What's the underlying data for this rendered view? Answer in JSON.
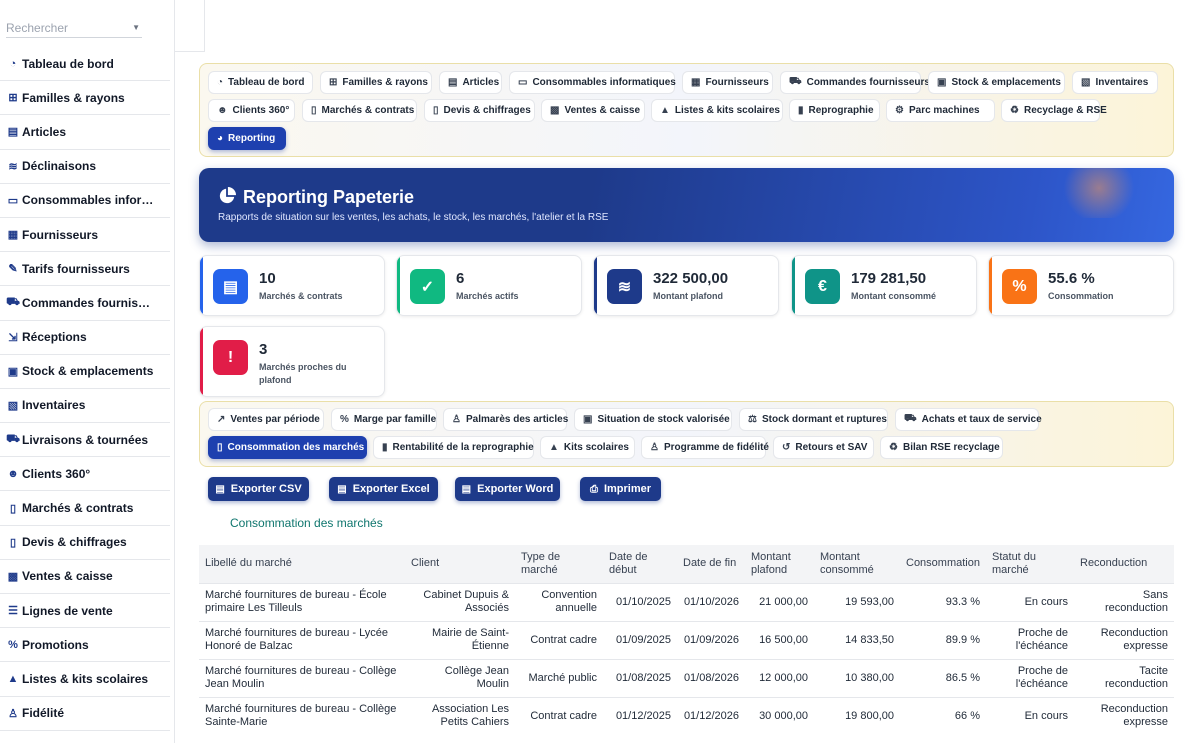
{
  "sidebar": {
    "search_placeholder": "Rechercher",
    "items": [
      {
        "label": "Tableau de bord",
        "icon": "gauge-icon"
      },
      {
        "label": "Familles & rayons",
        "icon": "sitemap-icon"
      },
      {
        "label": "Articles",
        "icon": "book-icon"
      },
      {
        "label": "Déclinaisons",
        "icon": "layers-icon"
      },
      {
        "label": "Consommables infor…",
        "icon": "printer-icon"
      },
      {
        "label": "Fournisseurs",
        "icon": "truck-loading-icon"
      },
      {
        "label": "Tarifs fournisseurs",
        "icon": "tags-icon"
      },
      {
        "label": "Commandes fournis…",
        "icon": "cart-icon"
      },
      {
        "label": "Réceptions",
        "icon": "dolly-icon"
      },
      {
        "label": "Stock & emplacements",
        "icon": "warehouse-icon"
      },
      {
        "label": "Inventaires",
        "icon": "clipboard-check-icon"
      },
      {
        "label": "Livraisons & tournées",
        "icon": "truck-icon"
      },
      {
        "label": "Clients 360°",
        "icon": "users-icon"
      },
      {
        "label": "Marchés & contrats",
        "icon": "file-contract-icon"
      },
      {
        "label": "Devis & chiffrages",
        "icon": "file-invoice-icon"
      },
      {
        "label": "Ventes & caisse",
        "icon": "cash-register-icon"
      },
      {
        "label": "Lignes de vente",
        "icon": "list-icon"
      },
      {
        "label": "Promotions",
        "icon": "percent-icon"
      },
      {
        "label": "Listes & kits scolaires",
        "icon": "graduation-cap-icon"
      },
      {
        "label": "Fidélité",
        "icon": "award-icon"
      }
    ]
  },
  "modules": [
    {
      "label": "Tableau de bord",
      "icon": "gauge-icon",
      "glyph": "◔"
    },
    {
      "label": "Familles & rayons",
      "icon": "sitemap-icon",
      "glyph": "⊞"
    },
    {
      "label": "Articles",
      "icon": "book-icon",
      "glyph": "▤"
    },
    {
      "label": "Consommables informatiques",
      "icon": "printer-icon",
      "glyph": "▭"
    },
    {
      "label": "Fournisseurs",
      "icon": "truck-loading-icon",
      "glyph": "▦"
    },
    {
      "label": "Commandes fournisseurs",
      "icon": "cart-icon",
      "glyph": "⛟"
    },
    {
      "label": "Stock & emplacements",
      "icon": "warehouse-icon",
      "glyph": "▣"
    },
    {
      "label": "Inventaires",
      "icon": "clipboard-check-icon",
      "glyph": "▧"
    },
    {
      "label": "Clients 360°",
      "icon": "users-icon",
      "glyph": "☻"
    },
    {
      "label": "Marchés & contrats",
      "icon": "file-contract-icon",
      "glyph": "▯"
    },
    {
      "label": "Devis & chiffrages",
      "icon": "file-invoice-icon",
      "glyph": "▯"
    },
    {
      "label": "Ventes & caisse",
      "icon": "cash-register-icon",
      "glyph": "▩"
    },
    {
      "label": "Listes & kits scolaires",
      "icon": "graduation-cap-icon",
      "glyph": "▲"
    },
    {
      "label": "Reprographie",
      "icon": "copy-icon",
      "glyph": "▮"
    },
    {
      "label": "Parc machines",
      "icon": "cogs-icon",
      "glyph": "⚙"
    },
    {
      "label": "Recyclage & RSE",
      "icon": "recycle-icon",
      "glyph": "♻"
    },
    {
      "label": "Reporting",
      "icon": "pie-chart-icon",
      "glyph": "◕",
      "active": true
    }
  ],
  "hero": {
    "title": "Reporting Papeterie",
    "subtitle": "Rapports de situation sur les ventes, les achats, le stock, les marchés, l'atelier et la RSE"
  },
  "kpis": [
    {
      "value": "10",
      "label": "Marchés & contrats",
      "color": "#2563eb",
      "icon": "file-icon",
      "glyph": "▤"
    },
    {
      "value": "6",
      "label": "Marchés actifs",
      "color": "#10b981",
      "icon": "check-circle-icon",
      "glyph": "✓"
    },
    {
      "value": "322 500,00",
      "label": "Montant plafond",
      "color": "#1e3a8a",
      "icon": "coins-icon",
      "glyph": "≋"
    },
    {
      "value": "179 281,50",
      "label": "Montant consommé",
      "color": "#0f9488",
      "icon": "euro-icon",
      "glyph": "€"
    },
    {
      "value": "55.6 %",
      "label": "Consommation",
      "color": "#f97316",
      "icon": "percent-icon",
      "glyph": "%"
    },
    {
      "value": "3",
      "label": "Marchés proches du plafond",
      "color": "#e11d48",
      "icon": "warning-icon",
      "glyph": "!"
    }
  ],
  "reports": [
    {
      "label": "Ventes par période",
      "icon": "chart-line-icon",
      "glyph": "↗"
    },
    {
      "label": "Marge par famille",
      "icon": "percent-icon",
      "glyph": "%"
    },
    {
      "label": "Palmarès des articles",
      "icon": "medal-icon",
      "glyph": "♙"
    },
    {
      "label": "Situation de stock valorisée",
      "icon": "warehouse-icon",
      "glyph": "▣"
    },
    {
      "label": "Stock dormant et ruptures",
      "icon": "balance-icon",
      "glyph": "⚖"
    },
    {
      "label": "Achats et taux de service",
      "icon": "cart-icon",
      "glyph": "⛟"
    },
    {
      "label": "Consommation des marchés",
      "icon": "file-contract-icon",
      "glyph": "▯",
      "active": true
    },
    {
      "label": "Rentabilité de la reprographie",
      "icon": "copy-icon",
      "glyph": "▮"
    },
    {
      "label": "Kits scolaires",
      "icon": "graduation-cap-icon",
      "glyph": "▲"
    },
    {
      "label": "Programme de fidélité",
      "icon": "award-icon",
      "glyph": "♙"
    },
    {
      "label": "Retours et SAV",
      "icon": "undo-icon",
      "glyph": "↺"
    },
    {
      "label": "Bilan RSE recyclage",
      "icon": "recycle-icon",
      "glyph": "♻"
    }
  ],
  "actions": {
    "csv": "Exporter CSV",
    "excel": "Exporter Excel",
    "word": "Exporter Word",
    "print": "Imprimer"
  },
  "report_title": "Consommation des marchés",
  "table": {
    "headers": [
      "Libellé du marché",
      "Client",
      "Type de marché",
      "Date de début",
      "Date de fin",
      "Montant plafond",
      "Montant consommé",
      "Consommation",
      "Statut du marché",
      "Reconduction"
    ],
    "rows": [
      [
        "Marché fournitures de bureau - École primaire Les Tilleuls",
        "Cabinet Dupuis & Associés",
        "Convention annuelle",
        "01/10/2025",
        "01/10/2026",
        "21 000,00",
        "19 593,00",
        "93.3 %",
        "En cours",
        "Sans reconduction"
      ],
      [
        "Marché fournitures de bureau - Lycée Honoré de Balzac",
        "Mairie de Saint-Étienne",
        "Contrat cadre",
        "01/09/2025",
        "01/09/2026",
        "16 500,00",
        "14 833,50",
        "89.9 %",
        "Proche de l'échéance",
        "Reconduction expresse"
      ],
      [
        "Marché fournitures de bureau - Collège Jean Moulin",
        "Collège Jean Moulin",
        "Marché public",
        "01/08/2025",
        "01/08/2026",
        "12 000,00",
        "10 380,00",
        "86.5 %",
        "Proche de l'échéance",
        "Tacite reconduction"
      ],
      [
        "Marché fournitures de bureau - Collège Sainte-Marie",
        "Association Les Petits Cahiers",
        "Contrat cadre",
        "01/12/2025",
        "01/12/2026",
        "30 000,00",
        "19 800,00",
        "66 %",
        "En cours",
        "Reconduction expresse"
      ]
    ]
  }
}
